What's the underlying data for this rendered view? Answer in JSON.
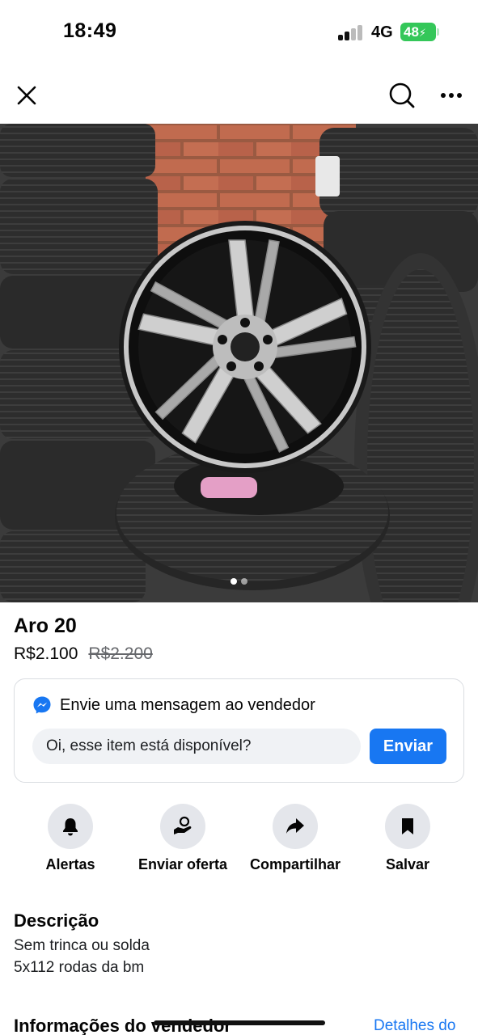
{
  "status_bar": {
    "time": "18:49",
    "network": "4G",
    "battery": "48"
  },
  "nav": {
    "close_icon": "close-icon",
    "search_icon": "search-icon",
    "more_icon": "more-icon"
  },
  "gallery": {
    "photo_count": 2,
    "active_index": 0
  },
  "listing": {
    "title": "Aro 20",
    "price": "R$2.100",
    "original_price": "R$2.200"
  },
  "message": {
    "header": "Envie uma mensagem ao vendedor",
    "input_value": "Oi, esse item está disponível?",
    "send_label": "Enviar",
    "icon": "messenger-icon"
  },
  "actions": [
    {
      "label": "Alertas",
      "icon": "bell-icon"
    },
    {
      "label": "Enviar oferta",
      "icon": "offer-hand-icon"
    },
    {
      "label": "Compartilhar",
      "icon": "share-icon"
    },
    {
      "label": "Salvar",
      "icon": "bookmark-icon"
    }
  ],
  "description": {
    "title": "Descrição",
    "lines": [
      "Sem trinca ou solda",
      "5x112 rodas da bm"
    ]
  },
  "seller": {
    "title": "Informações do vendedor",
    "details_link": "Detalhes do"
  },
  "colors": {
    "accent": "#1877f2",
    "battery": "#34c759"
  }
}
